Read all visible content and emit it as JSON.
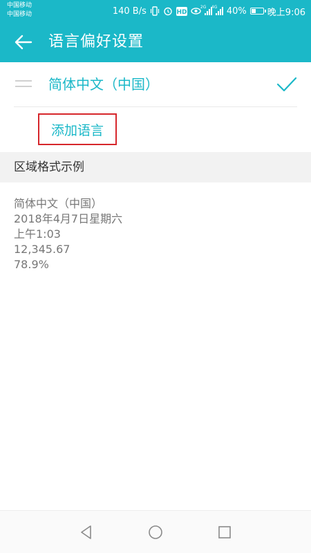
{
  "status_bar": {
    "carrier_1": "中国移动",
    "carrier_2": "中国移动",
    "net_speed": "140 B/s",
    "hd_badge": "HD",
    "net_type_1": "2G",
    "net_type_2": "4G",
    "battery_text": "40%",
    "battery_level": 0.4,
    "time": "晚上9:06",
    "icons": [
      "vibrate-icon",
      "alarm-icon",
      "hd-icon",
      "eye-icon",
      "signal-icon",
      "signal-icon",
      "battery-icon"
    ]
  },
  "app_bar": {
    "title": "语言偏好设置",
    "back_icon": "arrow-left-icon"
  },
  "languages": [
    {
      "name": "简体中文（中国）",
      "selected": true
    }
  ],
  "add_language_label": "添加语言",
  "region_section": {
    "title": "区域格式示例",
    "examples": [
      "简体中文（中国）",
      "2018年4月7日星期六",
      "上午1:03",
      "12,345.67",
      "78.9%"
    ]
  },
  "colors": {
    "accent": "#1bb8c8",
    "highlight_border": "#d6262b",
    "section_bg": "#f2f2f2"
  },
  "nav_bar": {
    "icons": [
      "back-triangle-icon",
      "home-circle-icon",
      "recents-square-icon"
    ]
  }
}
